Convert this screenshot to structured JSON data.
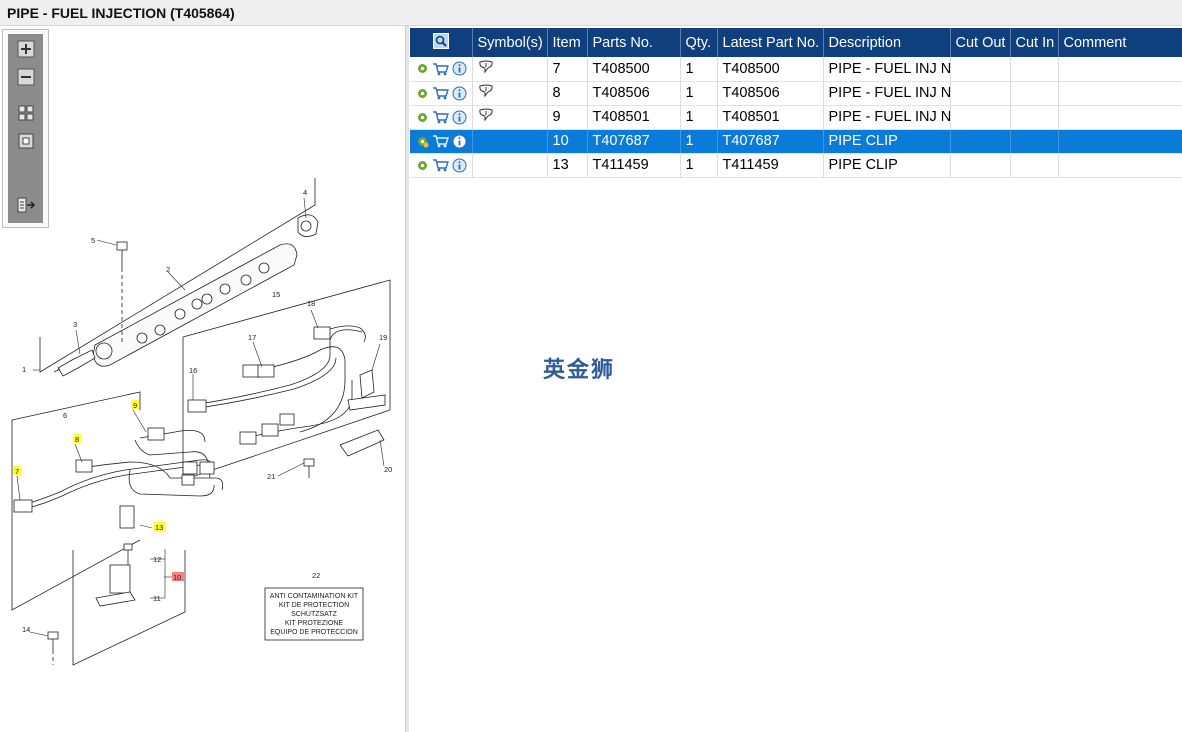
{
  "window": {
    "title": "PIPE - FUEL INJECTION (T405864)"
  },
  "toolbar": {
    "icons": [
      "zoom-in-icon",
      "zoom-out-icon",
      "fit-page-icon",
      "actual-size-icon",
      "export-icon"
    ]
  },
  "diagram": {
    "callouts": [
      "1",
      "2",
      "3",
      "4",
      "5",
      "6",
      "7",
      "8",
      "9",
      "10",
      "11",
      "12",
      "13",
      "14",
      "15",
      "16",
      "17",
      "18",
      "19",
      "20",
      "21",
      "22"
    ],
    "kit_label": [
      "ANTI CONTAMINATION KIT",
      "KIT DE PROTECTION",
      "SCHUTZSATZ",
      "KIT PROTEZIONE",
      "EQUIPO DE PROTECCION"
    ]
  },
  "table": {
    "headers": [
      "",
      "Symbol(s)",
      "Item",
      "Parts No.",
      "Qty.",
      "Latest Part No.",
      "Description",
      "Cut Out",
      "Cut In",
      "Comment"
    ],
    "rows": [
      {
        "item": "7",
        "parts_no": "T408500",
        "qty": "1",
        "latest": "T408500",
        "description": "PIPE - FUEL INJ NC",
        "cut_out": "",
        "cut_in": "",
        "comment": "",
        "symbol": true
      },
      {
        "item": "8",
        "parts_no": "T408506",
        "qty": "1",
        "latest": "T408506",
        "description": "PIPE - FUEL INJ NC",
        "cut_out": "",
        "cut_in": "",
        "comment": "",
        "symbol": true
      },
      {
        "item": "9",
        "parts_no": "T408501",
        "qty": "1",
        "latest": "T408501",
        "description": "PIPE - FUEL INJ NC",
        "cut_out": "",
        "cut_in": "",
        "comment": "",
        "symbol": true
      },
      {
        "item": "10",
        "parts_no": "T407687",
        "qty": "1",
        "latest": "T407687",
        "description": "PIPE CLIP",
        "cut_out": "",
        "cut_in": "",
        "comment": "",
        "symbol": false
      },
      {
        "item": "13",
        "parts_no": "T411459",
        "qty": "1",
        "latest": "T411459",
        "description": "PIPE CLIP",
        "cut_out": "",
        "cut_in": "",
        "comment": "",
        "symbol": false
      }
    ],
    "selected_item": "10"
  },
  "watermark": "英金狮",
  "colors": {
    "header_bg": "#0f3f7d",
    "selected_row": "#0a7bd8",
    "callout_highlight": "#ffff33",
    "callout_alert": "#ff7f7f"
  }
}
